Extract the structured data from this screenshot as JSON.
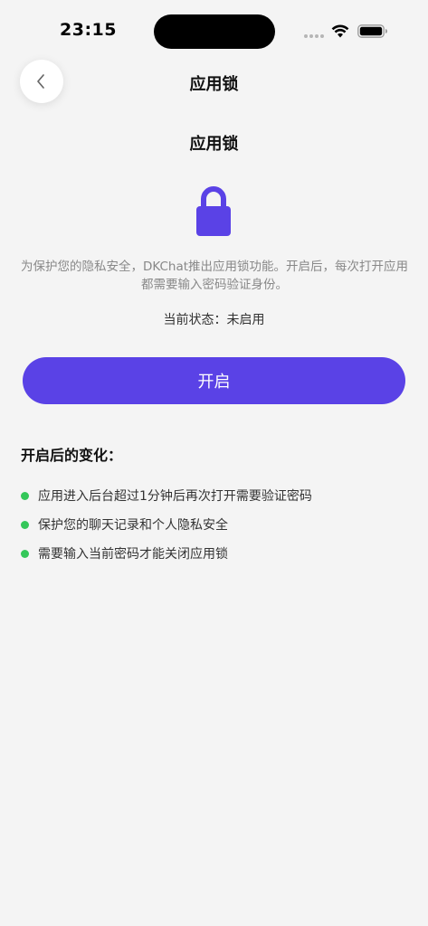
{
  "status_bar": {
    "time": "23:15"
  },
  "header": {
    "title": "应用锁",
    "back_icon": "chevron-left-icon"
  },
  "main": {
    "title": "应用锁",
    "lock_icon": "lock-icon",
    "description": "为保护您的隐私安全，DKChat推出应用锁功能。开启后，每次打开应用都需要输入密码验证身份。",
    "status_text": "当前状态：未启用",
    "enable_button_label": "开启",
    "changes_heading": "开启后的变化：",
    "changes": [
      "应用进入后台超过1分钟后再次打开需要验证密码",
      "保护您的聊天记录和个人隐私安全",
      "需要输入当前密码才能关闭应用锁"
    ]
  },
  "colors": {
    "accent": "#5a42e6",
    "bullet": "#34c759",
    "background": "#f4f4f4"
  }
}
